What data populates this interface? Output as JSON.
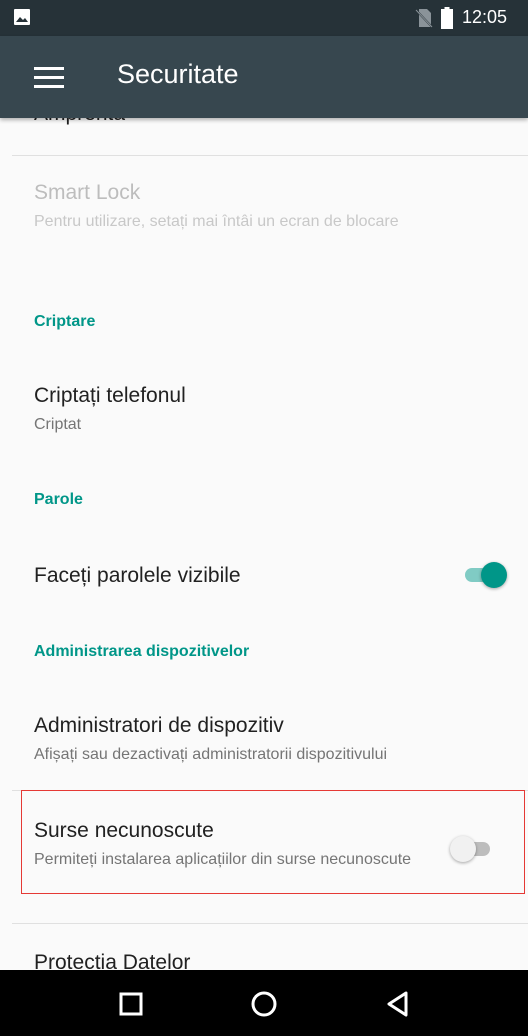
{
  "status_bar": {
    "time": "12:05"
  },
  "app_bar": {
    "title": "Securitate"
  },
  "settings": {
    "cut_top_item": "Amprentă",
    "smart_lock": {
      "title": "Smart Lock",
      "summary": "Pentru utilizare, setați mai întâi un ecran de blocare"
    },
    "sections": [
      {
        "header": "Criptare"
      },
      {
        "header": "Parole"
      },
      {
        "header": "Administrarea dispozitivelor"
      }
    ],
    "encrypt": {
      "title": "Criptați telefonul",
      "summary": "Criptat"
    },
    "show_passwords": {
      "title": "Faceți parolele vizibile",
      "enabled": true
    },
    "device_admins": {
      "title": "Administratori de dispozitiv",
      "summary": "Afișați sau dezactivați administratorii dispozitivului"
    },
    "unknown_sources": {
      "title": "Surse necunoscute",
      "summary": "Permiteți instalarea aplicațiilor din surse necunoscute",
      "enabled": false
    },
    "data_protection": {
      "title": "Protecția Datelor"
    }
  },
  "colors": {
    "accent": "#009688",
    "status_bar": "#263238",
    "app_bar": "#37474f",
    "highlight": "#e53935"
  }
}
